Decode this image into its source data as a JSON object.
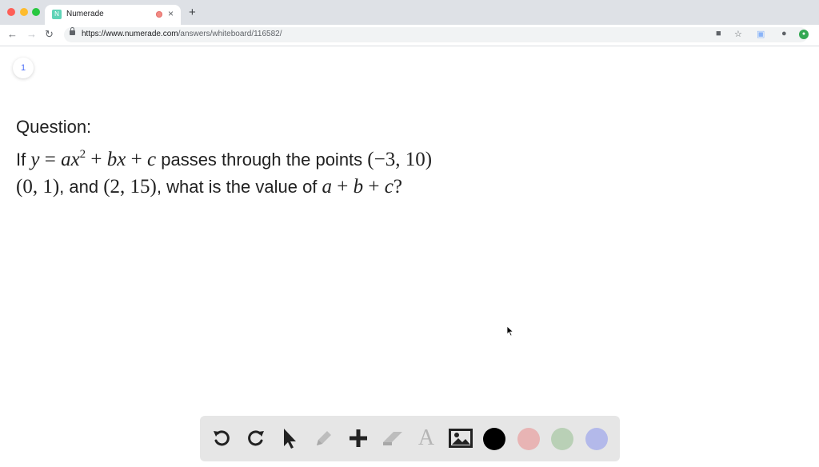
{
  "browser": {
    "tab_title": "Numerade",
    "favicon_text": "N",
    "new_tab": "+",
    "close_tab": "×",
    "url_host": "https://www.numerade.com",
    "url_path": "/answers/whiteboard/116582/"
  },
  "page": {
    "page_number": "1",
    "question_label": "Question:",
    "question_line1_prefix": "If ",
    "question_line1_text": " passes through the points ",
    "question_line2_text1": ", and ",
    "question_line2_text2": ", what is the value of "
  },
  "math": {
    "y": "y",
    "eq": " = ",
    "ax": "ax",
    "exp": "2",
    "plus1": " + ",
    "bx": "bx",
    "plus2": " + ",
    "c": "c",
    "point1": "(−3, 10)",
    "point2": "(0, 1)",
    "point3": "(2, 15)",
    "a": "a",
    "plus3": " + ",
    "b": "b",
    "plus4": " + ",
    "c2": "c",
    "qmark": "?"
  },
  "whiteboard_toolbar": {
    "tools": [
      "undo-icon",
      "redo-icon",
      "pointer-icon",
      "pencil-icon",
      "plus-icon",
      "eraser-icon",
      "text-icon",
      "image-icon"
    ],
    "text_tool_glyph": "A",
    "colors": [
      "#000000",
      "#e8b4b4",
      "#b9d0b6",
      "#b3b9ea"
    ]
  }
}
